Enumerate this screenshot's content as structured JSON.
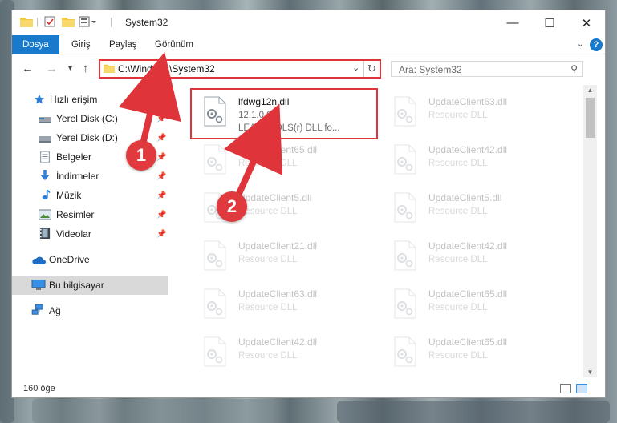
{
  "window": {
    "title": "System32",
    "controls": {
      "minimize": "—",
      "maximize": "☐",
      "close": "✕"
    }
  },
  "ribbon": {
    "tabs": [
      {
        "label": "Dosya"
      },
      {
        "label": "Giriş"
      },
      {
        "label": "Paylaş"
      },
      {
        "label": "Görünüm"
      }
    ],
    "help_label": "?"
  },
  "nav": {
    "back": "←",
    "forward": "→",
    "recent": "▾",
    "up": "↑",
    "address": "C:\\Windows\\System32",
    "search_placeholder": "Ara: System32"
  },
  "sidebar": {
    "items": [
      {
        "label": "Hızlı erişim",
        "icon": "star-icon"
      },
      {
        "label": "Yerel Disk (C:)",
        "icon": "drive-icon",
        "pinned": true
      },
      {
        "label": "Yerel Disk (D:)",
        "icon": "drive-icon",
        "pinned": true
      },
      {
        "label": "Belgeler",
        "icon": "documents-icon",
        "pinned": true
      },
      {
        "label": "İndirmeler",
        "icon": "downloads-icon",
        "pinned": true
      },
      {
        "label": "Müzik",
        "icon": "music-icon",
        "pinned": true
      },
      {
        "label": "Resimler",
        "icon": "pictures-icon",
        "pinned": true
      },
      {
        "label": "Videolar",
        "icon": "videos-icon",
        "pinned": true
      },
      {
        "label": "OneDrive",
        "icon": "cloud-icon"
      },
      {
        "label": "Bu bilgisayar",
        "icon": "computer-icon",
        "selected": true
      },
      {
        "label": "Ağ",
        "icon": "network-icon"
      }
    ]
  },
  "files": [
    {
      "name": "lfdwg12n.dll",
      "line2": "12.1.0.0",
      "line3": "LEADTOOLS(r) DLL fo...",
      "highlighted": true
    },
    {
      "name": "UpdateClient63.dll",
      "line2": "Resource DLL"
    },
    {
      "name": "UpdateClient65.dll",
      "line2": "Resource DLL"
    },
    {
      "name": "UpdateClient42.dll",
      "line2": "Resource DLL"
    },
    {
      "name": "UpdateClient5.dll",
      "line2": "Resource DLL"
    },
    {
      "name": "UpdateClient5.dll",
      "line2": "Resource DLL"
    },
    {
      "name": "UpdateClient21.dll",
      "line2": "Resource DLL"
    },
    {
      "name": "UpdateClient42.dll",
      "line2": "Resource DLL"
    },
    {
      "name": "UpdateClient63.dll",
      "line2": "Resource DLL"
    },
    {
      "name": "UpdateClient65.dll",
      "line2": "Resource DLL"
    },
    {
      "name": "UpdateClient42.dll",
      "line2": "Resource DLL"
    },
    {
      "name": "UpdateClient65.dll",
      "line2": "Resource DLL"
    }
  ],
  "status": {
    "item_count": "160 öğe"
  },
  "annotations": {
    "step1": "1",
    "step2": "2",
    "color": "#e0343b"
  },
  "colors": {
    "accent": "#1979ca",
    "highlight": "#e0343b",
    "selected_bg": "#d9d9d9"
  }
}
